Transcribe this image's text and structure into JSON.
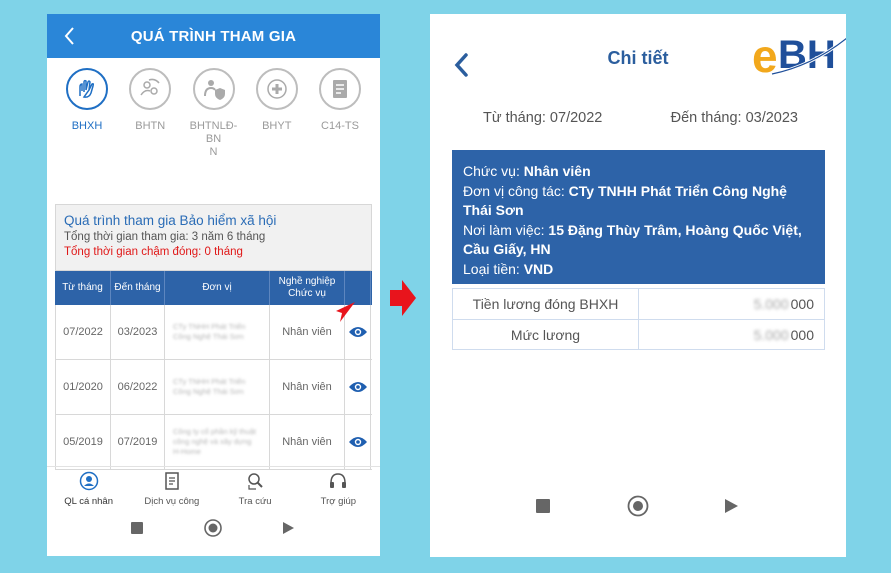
{
  "left": {
    "header_title": "QUÁ TRÌNH THAM GIA",
    "tabs": [
      {
        "label": "BHXH",
        "icon": "hands-icon"
      },
      {
        "label": "BHTN",
        "icon": "people-cycle-icon"
      },
      {
        "label": "BHTNLĐ-BN\nN",
        "icon": "shield-person-icon"
      },
      {
        "label": "BHYT",
        "icon": "medical-cross-icon"
      },
      {
        "label": "C14-TS",
        "icon": "document-icon"
      }
    ],
    "summary": {
      "title": "Quá trình tham gia Bảo hiểm xã hội",
      "total": "Tổng thời gian tham gia: 3 năm 6 tháng",
      "late": "Tổng thời gian chậm đóng: 0 tháng"
    },
    "table": {
      "headers": [
        "Từ tháng",
        "Đến tháng",
        "Đơn vị",
        "Nghề nghiệp\nChức vụ"
      ],
      "rows": [
        {
          "from": "07/2022",
          "to": "03/2023",
          "unit": "CTy TNHH Phát Triển Công Nghệ Thái Sơn",
          "job": "Nhân viên"
        },
        {
          "from": "01/2020",
          "to": "06/2022",
          "unit": "CTy TNHH Phát Triển Công Nghệ Thái Sơn",
          "job": "Nhân viên"
        },
        {
          "from": "05/2019",
          "to": "07/2019",
          "unit": "Công ty cổ phần kỹ thuật công nghệ và xây dựng H-Home",
          "job": "Nhân viên"
        }
      ]
    },
    "bottom_nav": [
      {
        "label": "QL cá nhân",
        "icon": "person-badge-icon"
      },
      {
        "label": "Dịch vụ công",
        "icon": "clipboard-icon"
      },
      {
        "label": "Tra cứu",
        "icon": "search-doc-icon"
      },
      {
        "label": "Trợ giúp",
        "icon": "headset-icon"
      }
    ]
  },
  "right": {
    "title": "Chi tiết",
    "logo_text": "eBH",
    "from_label": "Từ tháng: 07/2022",
    "to_label": "Đến tháng: 03/2023",
    "info": {
      "position_label": "Chức vụ: ",
      "position_value": "Nhân viên",
      "unit_label": "Đơn vị công tác: ",
      "unit_value": "CTy TNHH Phát Triển Công Nghệ Thái Sơn",
      "workplace_label": "Nơi làm việc: ",
      "workplace_value": "15 Đặng Thùy Trâm, Hoàng Quốc Việt, Cầu Giấy, HN",
      "currency_label": "Loại tiền: ",
      "currency_value": "VND"
    },
    "salary": [
      {
        "label": "Tiền lương đóng BHXH",
        "hidden": "5.000",
        "visible": "000"
      },
      {
        "label": "Mức lương",
        "hidden": "5.000",
        "visible": "000"
      }
    ]
  },
  "colors": {
    "accent": "#2a86d8",
    "table_head": "#2d63a8",
    "late_red": "#e01818",
    "arrow_red": "#e8141c"
  }
}
